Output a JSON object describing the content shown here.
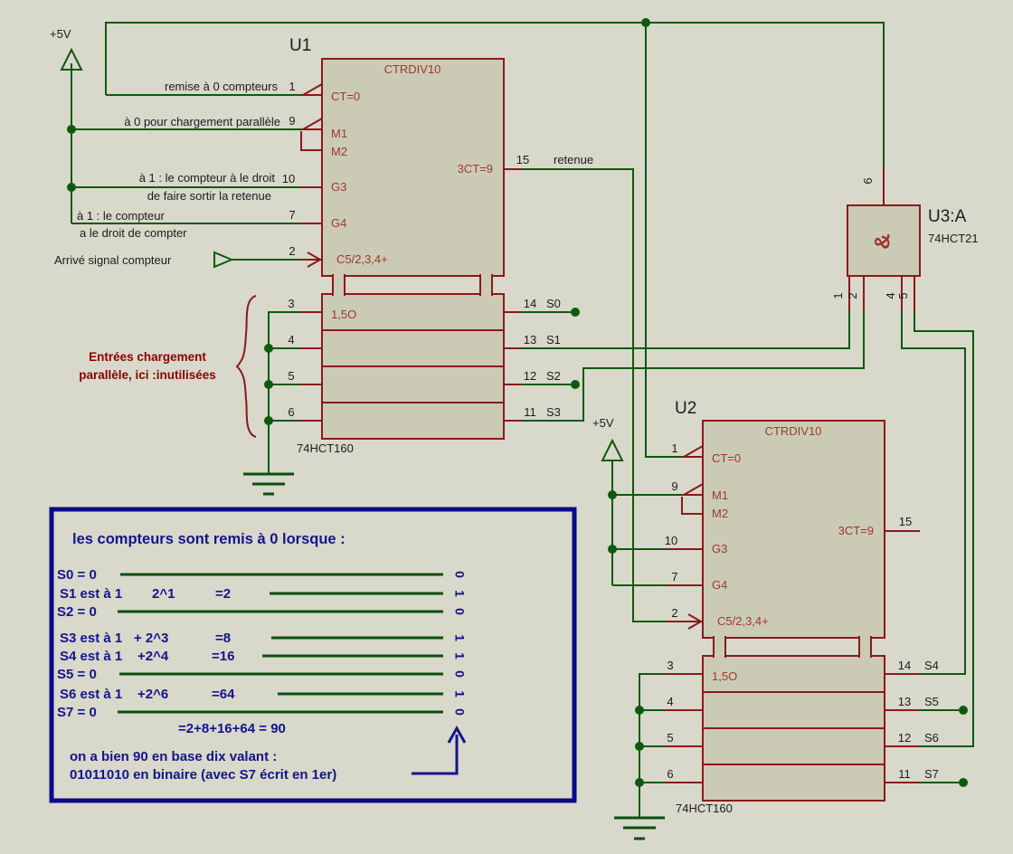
{
  "colors": {
    "background": "#d8d8cb",
    "chip_fill": "#cbcbb5",
    "chip_border": "#8c1919",
    "chip_text": "#9e372e",
    "wire_green": "#0d5a0d",
    "note_navy": "#14148c",
    "annotation_red": "#8b0000",
    "text_black": "#1c1c1c"
  },
  "power_label": "+5V",
  "u1": {
    "ref": "U1",
    "device": "CTRDIV10",
    "part": "74HCT160",
    "load_label": "1,5O",
    "fns": {
      "ct": "CT=0",
      "m1": "M1",
      "m2": "M2",
      "g3": "G3",
      "g4": "G4",
      "clk": "C5/2,3,4+",
      "carry": "3CT=9"
    },
    "nums": {
      "ct": "1",
      "m1": "9",
      "g3": "10",
      "g4": "7",
      "clk": "2",
      "carry": "15",
      "d0": "3",
      "d1": "4",
      "d2": "5",
      "d3": "6",
      "q0": "14",
      "q1": "13",
      "q2": "12",
      "q3": "11"
    },
    "nets": {
      "carry": "retenue",
      "q0": "S0",
      "q1": "S1",
      "q2": "S2",
      "q3": "S3"
    }
  },
  "u2": {
    "ref": "U2",
    "device": "CTRDIV10",
    "part": "74HCT160",
    "load_label": "1,5O",
    "fns": {
      "ct": "CT=0",
      "m1": "M1",
      "m2": "M2",
      "g3": "G3",
      "g4": "G4",
      "clk": "C5/2,3,4+",
      "carry": "3CT=9"
    },
    "nums": {
      "ct": "1",
      "m1": "9",
      "g3": "10",
      "g4": "7",
      "clk": "2",
      "carry": "15",
      "d0": "3",
      "d1": "4",
      "d2": "5",
      "d3": "6",
      "q0": "14",
      "q1": "13",
      "q2": "12",
      "q3": "11"
    },
    "nets": {
      "q0": "S4",
      "q1": "S5",
      "q2": "S6",
      "q3": "S7"
    }
  },
  "u3": {
    "ref": "U3:A",
    "part": "74HCT21",
    "symbol": "&",
    "nums": {
      "out": "6",
      "in1": "1",
      "in2": "2",
      "in3": "4",
      "in4": "5"
    }
  },
  "annotations": {
    "reset": "remise à 0 compteurs",
    "load_mode": "à 0 pour chargement parallèle",
    "carry_en_1": "à 1 : le compteur à le droit",
    "carry_en_2": "de faire sortir la retenue",
    "count_en_1": "à 1 : le compteur",
    "count_en_2": "a le droit de compter",
    "clock_in": "Arrivé signal compteur",
    "parallel_1": "Entrées chargement",
    "parallel_2": "parallèle, ici :inutilisées"
  },
  "note_box": {
    "title": "les compteurs sont remis à 0 lorsque :",
    "rows": [
      {
        "label": "S0 = 0",
        "term": "",
        "value": "",
        "bit": "0"
      },
      {
        "label": "S1 est à 1",
        "term": "2^1",
        "value": "=2",
        "bit": "1"
      },
      {
        "label": "S2 = 0",
        "term": "",
        "value": "",
        "bit": "0"
      },
      {
        "label": "S3 est à 1",
        "term": "+ 2^3",
        "value": "=8",
        "bit": "1"
      },
      {
        "label": "S4 est à 1",
        "term": "+2^4",
        "value": "=16",
        "bit": "1"
      },
      {
        "label": "S5 = 0",
        "term": "",
        "value": "",
        "bit": "0"
      },
      {
        "label": "S6 est à 1",
        "term": "+2^6",
        "value": "=64",
        "bit": "1"
      },
      {
        "label": "S7 = 0",
        "term": "",
        "value": "",
        "bit": "0"
      }
    ],
    "sum": "=2+8+16+64 = 90",
    "conclusion_1": "on a bien 90 en base dix valant :",
    "conclusion_2": "01011010 en binaire (avec S7 écrit en 1er)"
  }
}
